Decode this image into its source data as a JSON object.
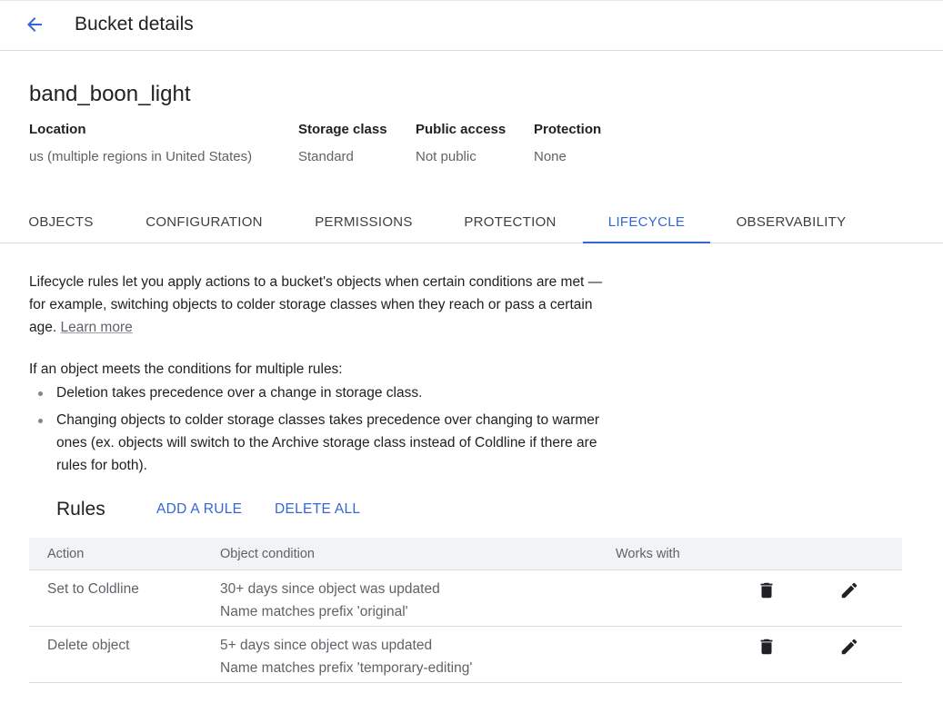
{
  "header": {
    "title": "Bucket details",
    "back_icon": "arrow-back-icon"
  },
  "bucket": {
    "name": "band_boon_light",
    "info": [
      {
        "label": "Location",
        "value": "us (multiple regions in United States)"
      },
      {
        "label": "Storage class",
        "value": "Standard"
      },
      {
        "label": "Public access",
        "value": "Not public"
      },
      {
        "label": "Protection",
        "value": "None"
      }
    ]
  },
  "tabs": [
    {
      "label": "OBJECTS",
      "active": false
    },
    {
      "label": "CONFIGURATION",
      "active": false
    },
    {
      "label": "PERMISSIONS",
      "active": false
    },
    {
      "label": "PROTECTION",
      "active": false
    },
    {
      "label": "LIFECYCLE",
      "active": true
    },
    {
      "label": "OBSERVABILITY",
      "active": false
    }
  ],
  "lifecycle": {
    "description": "Lifecycle rules let you apply actions to a bucket's objects when certain conditions are met — for example, switching objects to colder storage classes when they reach or pass a certain age.",
    "learn_more": "Learn more",
    "conditions_intro": "If an object meets the conditions for multiple rules:",
    "bullets": [
      "Deletion takes precedence over a change in storage class.",
      "Changing objects to colder storage classes takes precedence over changing to warmer ones (ex. objects will switch to the Archive storage class instead of Coldline if there are rules for both)."
    ]
  },
  "rules": {
    "title": "Rules",
    "add_label": "ADD A RULE",
    "delete_all_label": "DELETE ALL",
    "columns": [
      "Action",
      "Object condition",
      "Works with"
    ],
    "rows": [
      {
        "action": "Set to Coldline",
        "condition_1": "30+ days since object was updated",
        "condition_2": "Name matches prefix 'original'",
        "works_with": ""
      },
      {
        "action": "Delete object",
        "condition_1": "5+ days since object was updated",
        "condition_2": "Name matches prefix 'temporary-editing'",
        "works_with": ""
      }
    ],
    "delete_icon": "trash-icon",
    "edit_icon": "pencil-icon"
  },
  "colors": {
    "accent": "#3367d6",
    "text": "#202124",
    "secondary_text": "#5f6368",
    "divider": "#dadce0",
    "table_header_bg": "#f1f3f4"
  }
}
